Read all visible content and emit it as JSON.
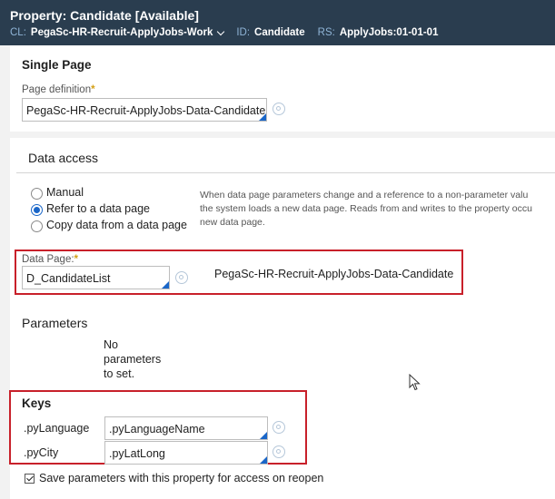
{
  "header": {
    "title": "Property: Candidate [Available]",
    "cl_label": "CL:",
    "cl_value": "PegaSc-HR-Recruit-ApplyJobs-Work",
    "id_label": "ID:",
    "id_value": "Candidate",
    "rs_label": "RS:",
    "rs_value": "ApplyJobs:01-01-01"
  },
  "single_page": {
    "heading": "Single Page",
    "page_definition_label": "Page definition",
    "page_definition_value": "PegaSc-HR-Recruit-ApplyJobs-Data-Candidate"
  },
  "data_access": {
    "heading": "Data access",
    "options": [
      {
        "label": "Manual",
        "selected": false
      },
      {
        "label": "Refer to a data page",
        "selected": true
      },
      {
        "label": "Copy data from a data page",
        "selected": false
      }
    ],
    "note_lines": [
      "When data page parameters change and a reference to a non-parameter valu",
      "the system loads a new data page. Reads from and writes to the property occu",
      "new data page."
    ],
    "data_page_label": "Data Page:",
    "data_page_value": "D_CandidateList",
    "data_page_class": "PegaSc-HR-Recruit-ApplyJobs-Data-Candidate"
  },
  "parameters": {
    "heading": "Parameters",
    "empty_lines": [
      "No",
      "parameters",
      "to set."
    ]
  },
  "keys": {
    "heading": "Keys",
    "rows": [
      {
        "name": ".pyLanguage",
        "value": ".pyLanguageName"
      },
      {
        "name": ".pyCity",
        "value": ".pyLatLong"
      }
    ]
  },
  "save_params": {
    "label": "Save parameters with this property for access on reopen",
    "checked": true
  },
  "colors": {
    "header_bg": "#2a3d4f",
    "accent": "#1a66c8",
    "highlight": "#c8202a"
  }
}
